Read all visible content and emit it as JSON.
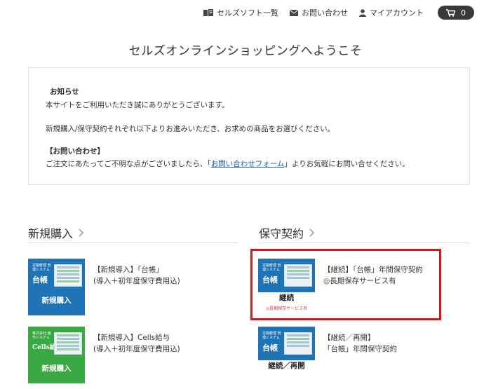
{
  "header": {
    "soft_list_label": "セルズソフト一覧",
    "contact_label": "お問い合わせ",
    "account_label": "マイアカウント",
    "cart_count": "0"
  },
  "welcome": "セルズオンラインショッピングへようこそ",
  "notice": {
    "heading": "お知らせ",
    "line1": "本サイトをご利用いただき誠にありがとうございます。",
    "line2": "新規購入/保守契約それぞれ以下よりお進みいただき、お求めの商品をお選びください。",
    "contact_heading": "【お問い合わせ】",
    "contact_before": "ご注文にあたってご不明な点がございましたら、「",
    "contact_link": "お問い合わせフォーム",
    "contact_after": "」よりお気軽にお問い合せください。"
  },
  "sections": {
    "new_title": "新規購入",
    "maint_title": "保守契約"
  },
  "products": {
    "new1": {
      "thumb_mini": "労務経理 管理システム",
      "thumb_logo": "台帳",
      "thumb_bottom": "新規購入",
      "line1": "【新規導入】「台帳」",
      "line2": "(導入＋初年度保守費用込)"
    },
    "new2": {
      "thumb_mini": "株式会社 給与システム",
      "thumb_logo": "Cells給与",
      "thumb_bottom": "新規購入",
      "line1": "【新規導入】Cells給与",
      "line2": "(導入＋初年度保守費用込)"
    },
    "maint1": {
      "thumb_mini": "労務経理 管理システム",
      "thumb_logo": "台帳",
      "thumb_bottom": "継続",
      "thumb_sub": "◎長期保存サービス有",
      "line1": "【継続】「台帳」年間保守契約",
      "line2": "◎長期保存サービス有"
    },
    "maint2": {
      "thumb_mini": "労務経理 管理システム",
      "thumb_logo": "台帳",
      "thumb_bottom": "継続／再開",
      "line1": "【継続／再開】",
      "line2": "「台帳」年間保守契約"
    }
  },
  "colors": {
    "thumb_blue": "#1f73b7",
    "thumb_green": "#3aa843",
    "highlight": "#d01818",
    "link": "#1a5aa8"
  }
}
